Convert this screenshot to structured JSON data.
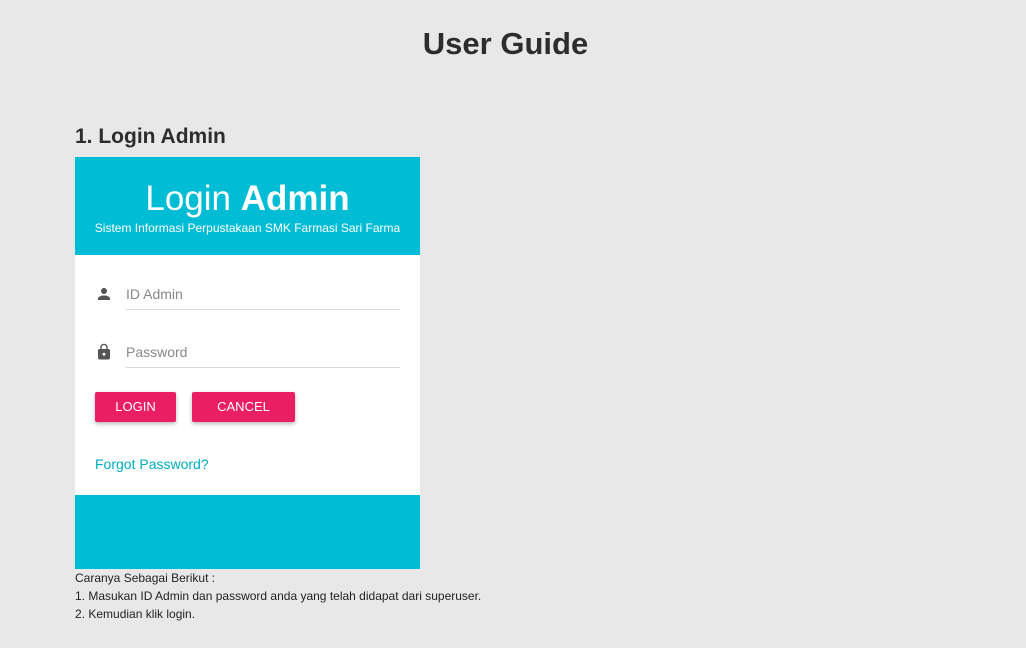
{
  "page": {
    "title": "User Guide"
  },
  "section": {
    "title": "1. Login Admin"
  },
  "login_form": {
    "title_light": "Login",
    "title_bold": "Admin",
    "subtitle": "Sistem Informasi Perpustakaan SMK Farmasi Sari Farma",
    "id_field": {
      "value": "",
      "placeholder": "ID Admin",
      "icon": "person-icon"
    },
    "password_field": {
      "value": "",
      "placeholder": "Password",
      "icon": "lock-icon"
    },
    "login_label": "LOGIN",
    "cancel_label": "CANCEL",
    "forgot_label": "Forgot Password?"
  },
  "instructions": {
    "intro": "Caranya Sebagai Berikut :",
    "steps": [
      "1. Masukan ID Admin dan password anda yang telah didapat dari superuser.",
      "2. Kemudian klik login."
    ]
  },
  "colors": {
    "background": "#e8e8e8",
    "header": "#00bcd4",
    "button": "#e91e63",
    "link": "#00acc1"
  }
}
